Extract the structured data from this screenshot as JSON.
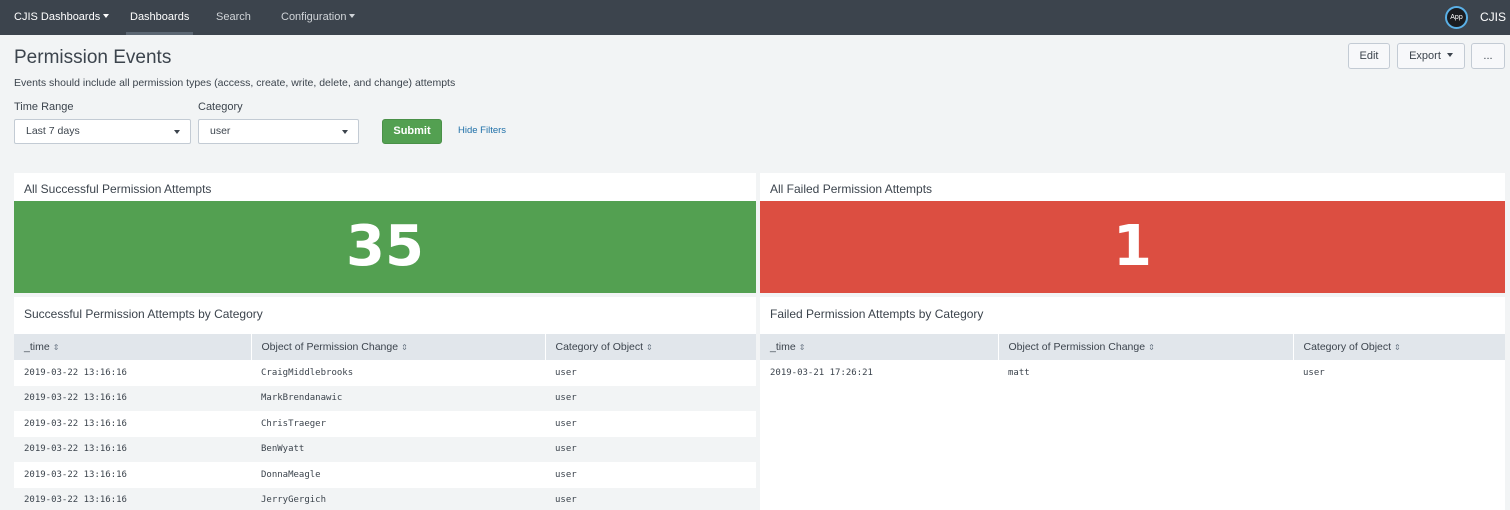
{
  "topbar": {
    "app_name": "CJIS Dashboards",
    "nav": {
      "dashboards": "Dashboards",
      "search": "Search",
      "configuration": "Configuration"
    },
    "app_badge": "App",
    "app_title": "CJIS"
  },
  "header": {
    "title": "Permission Events",
    "description": "Events should include all permission types (access, create, write, delete, and change) attempts",
    "buttons": {
      "edit": "Edit",
      "export": "Export",
      "more": "..."
    }
  },
  "filters": {
    "time_range": {
      "label": "Time Range",
      "value": "Last 7 days"
    },
    "category": {
      "label": "Category",
      "value": "user"
    },
    "submit": "Submit",
    "hide_filters": "Hide Filters"
  },
  "panels": {
    "success_single": {
      "title": "All Successful Permission Attempts",
      "value": "35",
      "color": "#53a051"
    },
    "failed_single": {
      "title": "All Failed Permission Attempts",
      "value": "1",
      "color": "#dc4e41"
    },
    "success_table": {
      "title": "Successful Permission Attempts by Category",
      "columns": [
        "_time",
        "Object of Permission Change",
        "Category of Object"
      ],
      "rows": [
        [
          "2019-03-22 13:16:16",
          "CraigMiddlebrooks",
          "user"
        ],
        [
          "2019-03-22 13:16:16",
          "MarkBrendanawic",
          "user"
        ],
        [
          "2019-03-22 13:16:16",
          "ChrisTraeger",
          "user"
        ],
        [
          "2019-03-22 13:16:16",
          "BenWyatt",
          "user"
        ],
        [
          "2019-03-22 13:16:16",
          "DonnaMeagle",
          "user"
        ],
        [
          "2019-03-22 13:16:16",
          "JerryGergich",
          "user"
        ]
      ]
    },
    "failed_table": {
      "title": "Failed Permission Attempts by Category",
      "columns": [
        "_time",
        "Object of Permission Change",
        "Category of Object"
      ],
      "rows": [
        [
          "2019-03-21 17:26:21",
          "matt",
          "user"
        ]
      ]
    }
  },
  "icons": {
    "sort": "sort-icon",
    "caret": "caret-down-icon"
  }
}
